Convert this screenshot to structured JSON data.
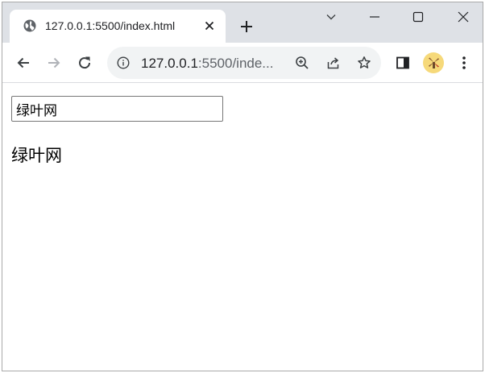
{
  "browser": {
    "tab": {
      "title": "127.0.0.1:5500/index.html"
    },
    "address_bar": {
      "host": "127.0.0.1",
      "path": ":5500/inde..."
    },
    "colors": {
      "tabstrip_bg": "#dee1e6",
      "omnibox_bg": "#f1f3f4",
      "icon": "#5f6368"
    }
  },
  "page": {
    "input_value": "绿叶网",
    "text": "绿叶网"
  }
}
